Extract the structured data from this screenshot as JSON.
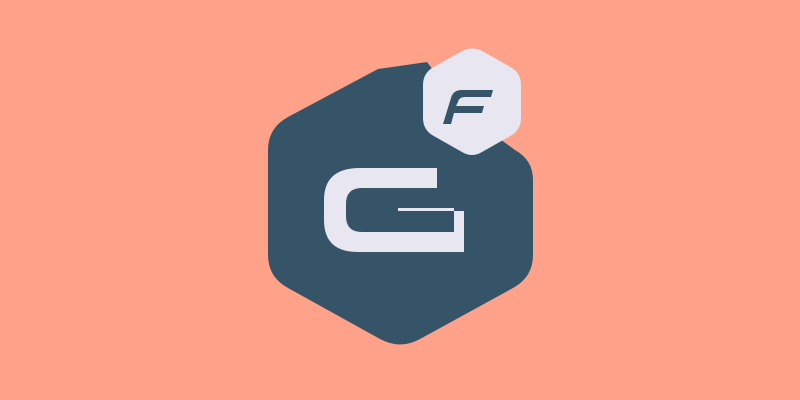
{
  "colors": {
    "background": "#FFA289",
    "hexagon": "#355467",
    "glyph": "#E8E7F1",
    "badge_letter": "#355467"
  },
  "logo": {
    "main_letter": "G",
    "badge_letter": "F",
    "main_icon": "hexagon-g-logo-icon",
    "badge_icon": "hexagon-f-badge-icon"
  }
}
